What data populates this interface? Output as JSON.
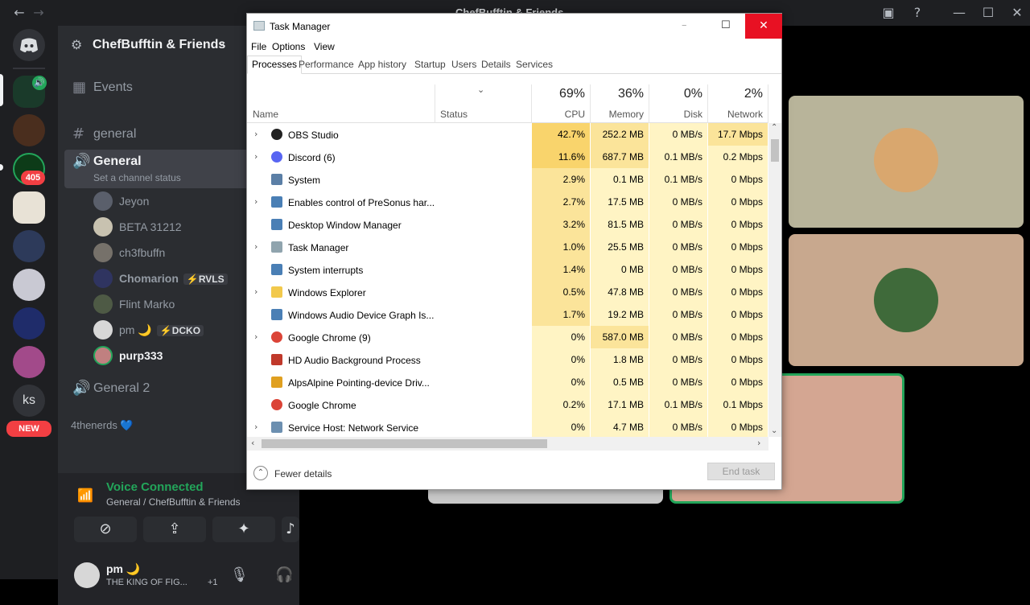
{
  "discord": {
    "window_title": "ChefBufftin & Friends",
    "guild_name": "ChefBufftin & Friends",
    "rail": {
      "badge_405": "405",
      "ks_label": "ks",
      "new_label": "NEW"
    },
    "channels": {
      "events": "Events",
      "general_text": "general",
      "general_voice": "General",
      "general_voice_status": "Set a channel status",
      "general2": "General 2",
      "category": "4thenerds 💙"
    },
    "voice_users": [
      {
        "name": "Jeyon"
      },
      {
        "name": "BETA 31212"
      },
      {
        "name": "ch3fbuffn"
      },
      {
        "name": "Chomarion",
        "tag": "⚡RVLS"
      },
      {
        "name": "Flint Marko"
      },
      {
        "name": "pm 🌙",
        "tag": "⚡DCKO"
      },
      {
        "name": "purp333"
      }
    ],
    "voice_panel": {
      "status": "Voice Connected",
      "location": "General / ChefBufftin & Friends"
    },
    "user_panel": {
      "name": "pm 🌙",
      "activity": "THE KING OF FIG...",
      "extra": "+1"
    }
  },
  "task_manager": {
    "title": "Task Manager",
    "menu": [
      "File",
      "Options",
      "View"
    ],
    "tabs": [
      "Processes",
      "Performance",
      "App history",
      "Startup",
      "Users",
      "Details",
      "Services"
    ],
    "columns": {
      "name": "Name",
      "status": "Status",
      "cpu": {
        "pct": "69%",
        "label": "CPU"
      },
      "memory": {
        "pct": "36%",
        "label": "Memory"
      },
      "disk": {
        "pct": "0%",
        "label": "Disk"
      },
      "network": {
        "pct": "2%",
        "label": "Network"
      }
    },
    "processes": [
      {
        "name": "OBS Studio",
        "expand": true,
        "icon": "obs-icon",
        "cpu": "42.7%",
        "memory": "252.2 MB",
        "disk": "0 MB/s",
        "network": "17.7 Mbps"
      },
      {
        "name": "Discord (6)",
        "expand": true,
        "icon": "discord-icon",
        "cpu": "11.6%",
        "memory": "687.7 MB",
        "disk": "0.1 MB/s",
        "network": "0.2 Mbps"
      },
      {
        "name": "System",
        "expand": false,
        "icon": "system-icon",
        "cpu": "2.9%",
        "memory": "0.1 MB",
        "disk": "0.1 MB/s",
        "network": "0 Mbps"
      },
      {
        "name": "Enables control of PreSonus har...",
        "expand": true,
        "icon": "app-icon",
        "cpu": "2.7%",
        "memory": "17.5 MB",
        "disk": "0 MB/s",
        "network": "0 Mbps"
      },
      {
        "name": "Desktop Window Manager",
        "expand": false,
        "icon": "app-icon",
        "cpu": "3.2%",
        "memory": "81.5 MB",
        "disk": "0 MB/s",
        "network": "0 Mbps"
      },
      {
        "name": "Task Manager",
        "expand": true,
        "icon": "taskmgr-icon",
        "cpu": "1.0%",
        "memory": "25.5 MB",
        "disk": "0 MB/s",
        "network": "0 Mbps"
      },
      {
        "name": "System interrupts",
        "expand": false,
        "icon": "app-icon",
        "cpu": "1.4%",
        "memory": "0 MB",
        "disk": "0 MB/s",
        "network": "0 Mbps"
      },
      {
        "name": "Windows Explorer",
        "expand": true,
        "icon": "folder-icon",
        "cpu": "0.5%",
        "memory": "47.8 MB",
        "disk": "0 MB/s",
        "network": "0 Mbps"
      },
      {
        "name": "Windows Audio Device Graph Is...",
        "expand": false,
        "icon": "app-icon",
        "cpu": "1.7%",
        "memory": "19.2 MB",
        "disk": "0 MB/s",
        "network": "0 Mbps"
      },
      {
        "name": "Google Chrome (9)",
        "expand": true,
        "icon": "chrome-icon",
        "cpu": "0%",
        "memory": "587.0 MB",
        "disk": "0 MB/s",
        "network": "0 Mbps"
      },
      {
        "name": "HD Audio Background Process",
        "expand": false,
        "icon": "speaker-icon",
        "cpu": "0%",
        "memory": "1.8 MB",
        "disk": "0 MB/s",
        "network": "0 Mbps"
      },
      {
        "name": "AlpsAlpine Pointing-device Driv...",
        "expand": false,
        "icon": "pineapple-icon",
        "cpu": "0%",
        "memory": "0.5 MB",
        "disk": "0 MB/s",
        "network": "0 Mbps"
      },
      {
        "name": "Google Chrome",
        "expand": false,
        "icon": "chrome-icon",
        "cpu": "0.2%",
        "memory": "17.1 MB",
        "disk": "0.1 MB/s",
        "network": "0.1 Mbps"
      },
      {
        "name": "Service Host: Network Service",
        "expand": true,
        "icon": "gear-icon",
        "cpu": "0%",
        "memory": "4.7 MB",
        "disk": "0 MB/s",
        "network": "0 Mbps"
      }
    ],
    "footer": {
      "fewer_details": "Fewer details",
      "end_task": "End task"
    },
    "colors": {
      "heat_high": "#f9d46c",
      "heat_mid": "#fbe49a",
      "heat_low": "#fff4c4",
      "close_red": "#e81123"
    }
  }
}
